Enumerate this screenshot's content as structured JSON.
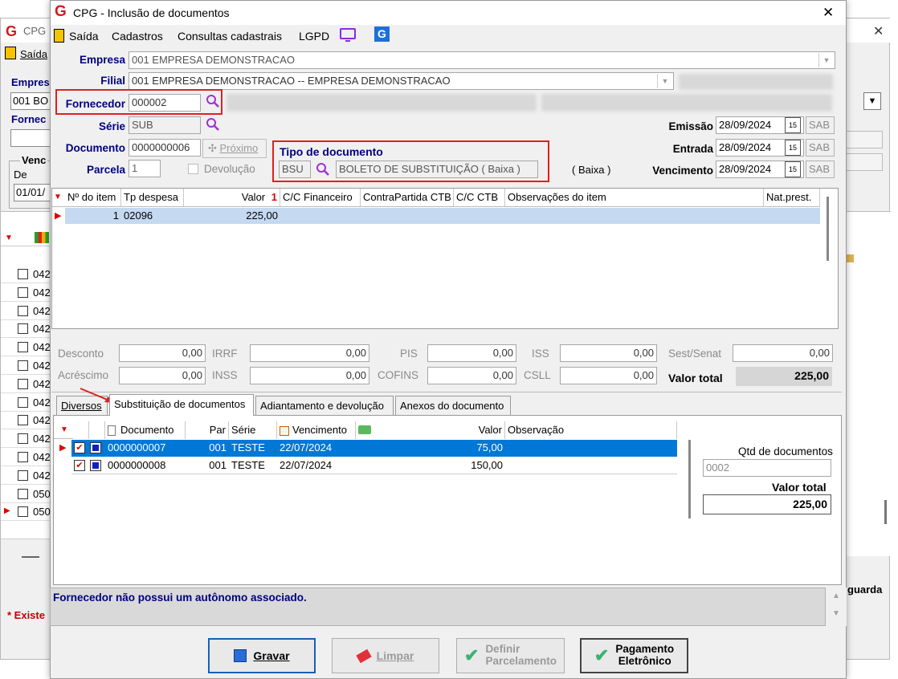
{
  "bg_window": {
    "title": "CPG",
    "menu_saida": "Saída",
    "empresa_label": "Empres",
    "empresa_value": "001 BO",
    "fornecedor_label": "Fornec",
    "venc_label": "Venc",
    "de_label": "De",
    "date_value": "01/01/",
    "list_codes": [
      "042",
      "042",
      "042",
      "042",
      "042",
      "042",
      "042",
      "042",
      "042",
      "042",
      "042",
      "042",
      "050",
      "050"
    ],
    "footer_text": "* Existe",
    "guarda_label": "guarda"
  },
  "window": {
    "title": "CPG - Inclusão de documentos",
    "close": "✕"
  },
  "menu": [
    "Saída",
    "Cadastros",
    "Consultas cadastrais",
    "LGPD"
  ],
  "form": {
    "empresa_label": "Empresa",
    "empresa_value": "001 EMPRESA DEMONSTRACAO",
    "filial_label": "Filial",
    "filial_value": "001 EMPRESA DEMONSTRACAO -- EMPRESA DEMONSTRACAO",
    "fornecedor_label": "Fornecedor",
    "fornecedor_value": "000002",
    "serie_label": "Série",
    "serie_value": "SUB",
    "documento_label": "Documento",
    "documento_value": "0000000006",
    "proximo_label": "Próximo",
    "parcela_label": "Parcela",
    "parcela_value": "1",
    "devolucao_label": "Devolução",
    "tipo_doc_label": "Tipo de documento",
    "tipo_doc_code": "BSU",
    "tipo_doc_desc": "BOLETO DE SUBSTITUIÇÃO ( Baixa )",
    "tipo_doc_tag": "( Baixa )",
    "emissao_label": "Emissão",
    "emissao_value": "28/09/2024",
    "entrada_label": "Entrada",
    "entrada_value": "28/09/2024",
    "vencimento_label": "Vencimento",
    "vencimento_value": "28/09/2024",
    "day_abbrev": "SAB",
    "cal_icon_text": "15"
  },
  "items_grid": {
    "headers": [
      "Nº do item",
      "Tp despesa",
      "Valor",
      "C/C Financeiro",
      "ContraPartida CTB",
      "C/C CTB",
      "Observações do item",
      "Nat.prest."
    ],
    "rows": [
      {
        "item": "1",
        "tp": "02096",
        "valor": "225,00"
      }
    ]
  },
  "totals": {
    "desconto_label": "Desconto",
    "desconto": "0,00",
    "irrf_label": "IRRF",
    "irrf": "0,00",
    "pis_label": "PIS",
    "pis": "0,00",
    "iss_label": "ISS",
    "iss": "0,00",
    "sest_label": "Sest/Senat",
    "sest": "0,00",
    "acrescimo_label": "Acréscimo",
    "acrescimo": "0,00",
    "inss_label": "INSS",
    "inss": "0,00",
    "cofins_label": "COFINS",
    "cofins": "0,00",
    "csll_label": "CSLL",
    "csll": "0,00",
    "valor_total_label": "Valor total",
    "valor_total": "225,00"
  },
  "tabs": [
    "Diversos",
    "Substituição de documentos",
    "Adiantamento e devolução",
    "Anexos do documento"
  ],
  "docs_grid": {
    "headers": [
      "Documento",
      "Par",
      "Série",
      "Vencimento",
      "Valor",
      "Observação"
    ],
    "rows": [
      {
        "documento": "0000000007",
        "par": "001",
        "serie": "TESTE",
        "venc": "22/07/2024",
        "valor": "75,00"
      },
      {
        "documento": "0000000008",
        "par": "001",
        "serie": "TESTE",
        "venc": "22/07/2024",
        "valor": "150,00"
      }
    ]
  },
  "side_panel": {
    "qtd_label": "Qtd de documentos",
    "qtd_value": "0002",
    "valor_total_label": "Valor total",
    "valor_total": "225,00"
  },
  "message": "Fornecedor não possui um autônomo associado.",
  "buttons": {
    "gravar": "Gravar",
    "limpar": "Limpar",
    "definir_1": "Definir",
    "definir_2": "Parcelamento",
    "pagamento_1": "Pagamento",
    "pagamento_2": "Eletrônico"
  },
  "colors": {
    "accent": "#0078d7",
    "label_blue": "#000080",
    "highlight": "#e02020"
  }
}
